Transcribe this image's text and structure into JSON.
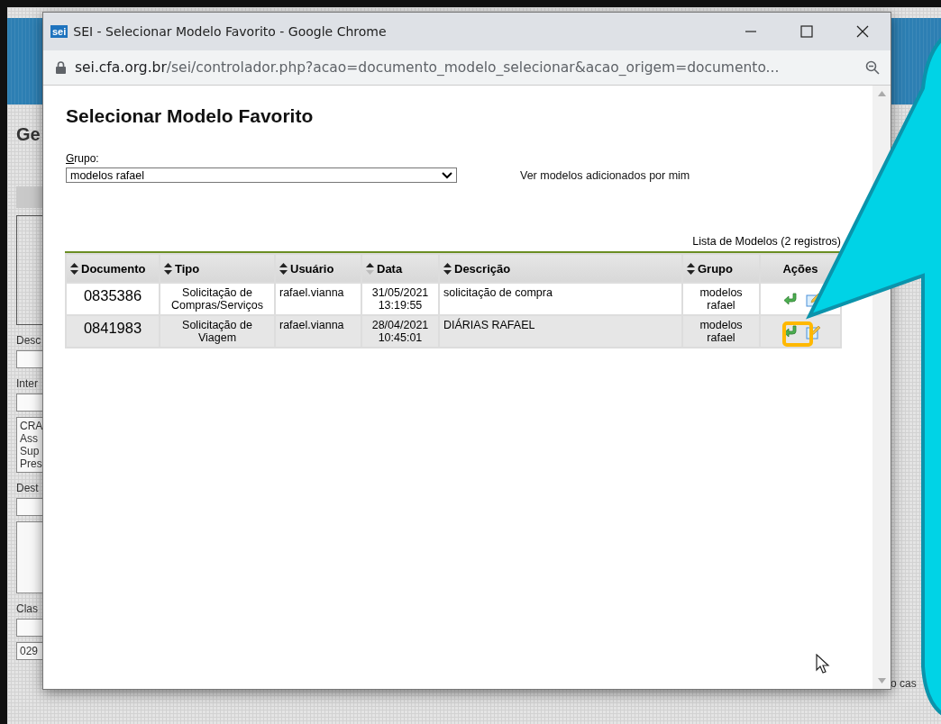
{
  "background_page": {
    "heading": "Ge",
    "labels": [
      "Desc",
      "Inter",
      "Dest",
      "Clas"
    ],
    "list_items": [
      "CRA",
      "Ass",
      "Sup",
      "Pres"
    ],
    "field_value": "029",
    "side_text": "o cas"
  },
  "window": {
    "logo": "sei",
    "title": "SEI - Selecionar Modelo Favorito - Google Chrome",
    "url_host": "sei.cfa.org.br",
    "url_path": "/sei/controlador.php?acao=documento_modelo_selecionar&acao_origem=documento..."
  },
  "page": {
    "title": "Selecionar Modelo Favorito",
    "group_label": "Grupo:",
    "group_value": "modelos rafael",
    "my_models_link": "Ver modelos adicionados por mim",
    "table_caption": "Lista de Modelos (2 registros)"
  },
  "table": {
    "columns": [
      {
        "label": "Documento",
        "sortable": true,
        "sorted": false
      },
      {
        "label": "Tipo",
        "sortable": true,
        "sorted": false
      },
      {
        "label": "Usuário",
        "sortable": true,
        "sorted": false
      },
      {
        "label": "Data",
        "sortable": true,
        "sorted": true
      },
      {
        "label": "Descrição",
        "sortable": true,
        "sorted": false
      },
      {
        "label": "Grupo",
        "sortable": true,
        "sorted": false
      },
      {
        "label": "Ações",
        "sortable": false
      }
    ],
    "rows": [
      {
        "documento": "0835386",
        "tipo": "Solicitação de Compras/Serviços",
        "usuario": "rafael.vianna",
        "data": "31/05/2021",
        "hora": "13:19:55",
        "descricao": "solicitação de compra",
        "grupo": "modelos rafael",
        "highlighted": false
      },
      {
        "documento": "0841983",
        "tipo": "Solicitação de Viagem",
        "usuario": "rafael.vianna",
        "data": "28/04/2021",
        "hora": "10:45:01",
        "descricao": "DIÁRIAS RAFAEL",
        "grupo": "modelos rafael",
        "highlighted": true
      }
    ]
  }
}
